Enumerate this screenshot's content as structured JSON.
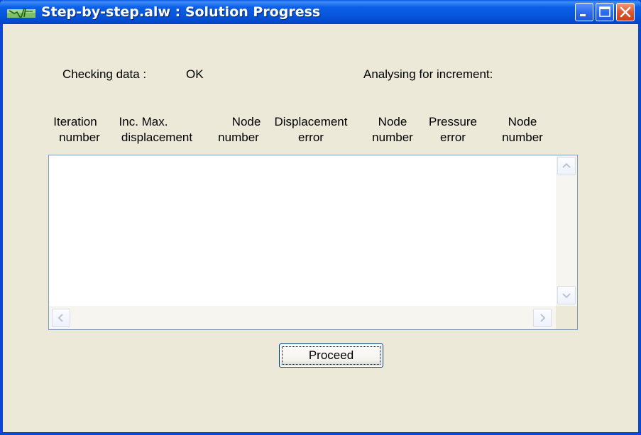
{
  "window": {
    "title": "Step-by-step.alw : Solution Progress",
    "title_bar_color": "#0a58e8",
    "close_button_color": "#e25a31",
    "background_color": "#ece9d8",
    "icons": [
      "app-icon",
      "minimize-icon",
      "maximize-icon",
      "close-icon"
    ]
  },
  "status": {
    "checking_label": "Checking data :",
    "checking_value": "OK",
    "analysing_label": "Analysing for increment:"
  },
  "columns": [
    {
      "line1": "Iteration",
      "line2": "number"
    },
    {
      "line1": "Inc. Max.",
      "line2": "displacement"
    },
    {
      "line1": "Node",
      "line2": "number"
    },
    {
      "line1": "Displacement",
      "line2": "error"
    },
    {
      "line1": "Node",
      "line2": "number"
    },
    {
      "line1": "Pressure",
      "line2": "error"
    },
    {
      "line1": "Node",
      "line2": "number"
    }
  ],
  "results": {
    "rows": []
  },
  "actions": {
    "proceed_label": "Proceed"
  }
}
